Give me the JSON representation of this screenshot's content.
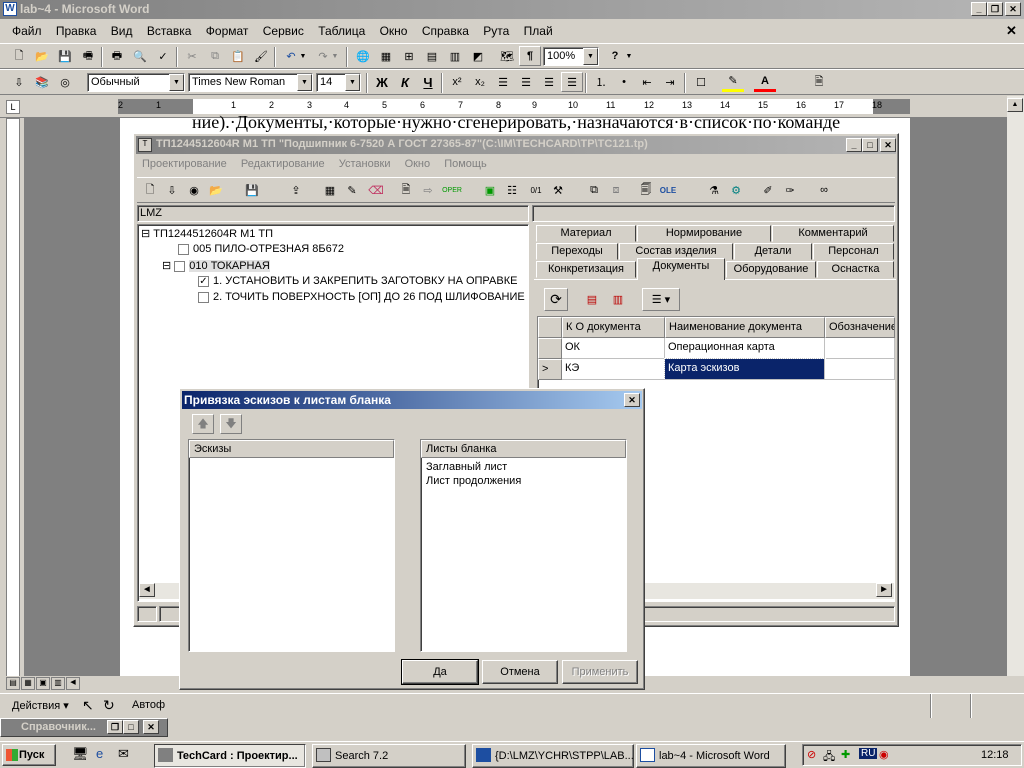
{
  "word": {
    "title": "lab~4 - Microsoft Word",
    "menu": [
      "Файл",
      "Правка",
      "Вид",
      "Вставка",
      "Формат",
      "Сервис",
      "Таблица",
      "Окно",
      "Справка",
      "Рута",
      "Плай"
    ],
    "zoom": "100%",
    "style": "Обычный",
    "font": "Times New Roman",
    "size": "14",
    "bold": "Ж",
    "italic": "К",
    "underline": "Ч",
    "doc_line": "ние).·Документы,·которые·нужно·сгенерировать,·назначаются·в·список·по·команде",
    "draw_label": "Действия ▾",
    "autoshapes": "Автоф",
    "ruler_nums": [
      "2",
      "1",
      "1",
      "2",
      "3",
      "4",
      "5",
      "6",
      "7",
      "8",
      "9",
      "10",
      "11",
      "12",
      "13",
      "14",
      "15",
      "16",
      "17",
      "18"
    ]
  },
  "techcard": {
    "title": "ТП1244512604R М1 ТП \"Подшипник 6-7520 А ГОСТ 27365-87\"(C:\\IM\\TECHCARD\\TP\\TC121.tp)",
    "menu": [
      "Проектирование",
      "Редактирование",
      "Установки",
      "Окно",
      "Помощь"
    ],
    "left_label": "LMZ",
    "tree": {
      "root": "ТП1244512604R М1 ТП",
      "op1": "005  ПИЛО-ОТРЕЗНАЯ   8Б672",
      "op2": "010  ТОКАРНАЯ",
      "step1": "1. УСТАНОВИТЬ И ЗАКРЕПИТЬ ЗАГОТОВКУ НА ОПРАВКЕ",
      "step2": "2. ТОЧИТЬ ПОВЕРХНОСТЬ [ОП] ДО 26 ПОД ШЛИФОВАНИЕ"
    },
    "tabs_row1": [
      "Материал",
      "Нормирование",
      "Комментарий"
    ],
    "tabs_row2": [
      "Переходы",
      "Состав изделия",
      "Детали",
      "Персонал"
    ],
    "tabs_row3": [
      "Конкретизация",
      "Документы",
      "Оборудование",
      "Оснастка"
    ],
    "grid": {
      "headers": [
        "К О  документа",
        "Наименование документа",
        "Обозначение"
      ],
      "rows": [
        {
          "code": "ОК",
          "name": "Операционная карта",
          "mark": ""
        },
        {
          "code": "КЭ",
          "name": "Карта эскизов",
          "mark": ">"
        }
      ]
    }
  },
  "dialog": {
    "title": "Привязка эскизов к листам бланка",
    "left_header": "Эскизы",
    "right_header": "Листы бланка",
    "sheets": [
      "Заглавный лист",
      "Лист продолжения"
    ],
    "ok": "Да",
    "cancel": "Отмена",
    "apply": "Применить"
  },
  "mini_window": {
    "title": "Справочник..."
  },
  "taskbar": {
    "start": "Пуск",
    "tasks": [
      "TechCard : Проектир...",
      "Search 7.2",
      "{D:\\LMZ\\YCHR\\STPP\\LAB...",
      "lab~4 - Microsoft Word"
    ],
    "tray_lang": "RU",
    "clock": "12:18"
  }
}
